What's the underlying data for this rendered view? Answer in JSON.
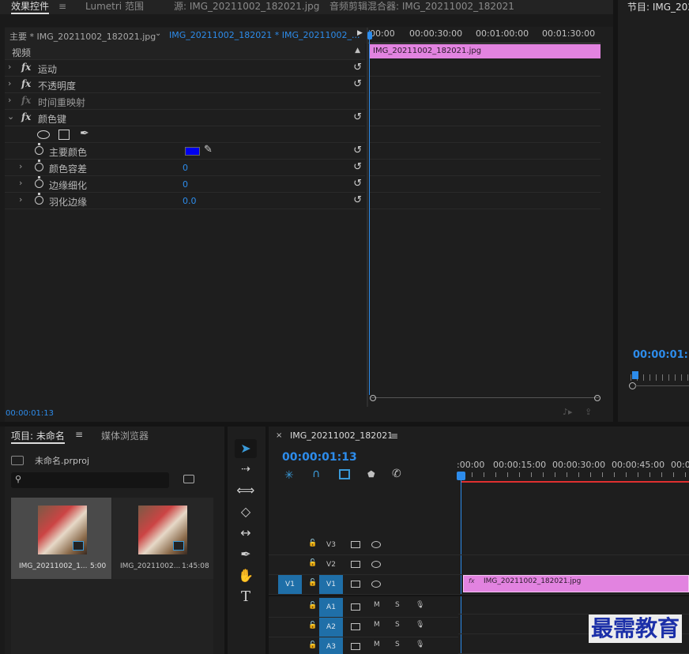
{
  "top_tabs": {
    "effect_controls": "效果控件",
    "lumetri": "Lumetri 范围",
    "source": "源: IMG_20211002_182021.jpg",
    "audio_mixer": "音频剪辑混合器: IMG_20211002_182021",
    "program": "节目: IMG_202"
  },
  "effect_controls": {
    "master_clip": "主要 * IMG_20211002_182021.jpg",
    "sequence_clip": "IMG_20211002_182021 * IMG_20211002_...",
    "section_video": "视频",
    "effects": [
      {
        "label": "运动"
      },
      {
        "label": "不透明度"
      },
      {
        "label": "时间重映射"
      },
      {
        "label": "颜色键"
      }
    ],
    "params": [
      {
        "label": "主要颜色",
        "value": ""
      },
      {
        "label": "颜色容差",
        "value": "0"
      },
      {
        "label": "边缘细化",
        "value": "0"
      },
      {
        "label": "羽化边缘",
        "value": "0.0"
      }
    ],
    "key_color": "#0000ee",
    "ruler": [
      "00:00",
      "00:00:30:00",
      "00:01:00:00",
      "00:01:30:00"
    ],
    "clip_name": "IMG_20211002_182021.jpg",
    "current_time": "00:00:01:13"
  },
  "program_monitor": {
    "timecode": "00:00:01:13"
  },
  "project": {
    "tab_project": "项目: 未命名",
    "tab_media": "媒体浏览器",
    "file_name": "未命名.prproj",
    "search_placeholder": "",
    "items": [
      {
        "name": "IMG_20211002_1...",
        "duration": "5:00"
      },
      {
        "name": "IMG_20211002...",
        "duration": "1:45:08"
      }
    ]
  },
  "timeline": {
    "sequence_name": "IMG_20211002_182021",
    "timecode": "00:00:01:13",
    "ruler": [
      ":00:00",
      "00:00:15:00",
      "00:00:30:00",
      "00:00:45:00",
      "00:0"
    ],
    "video_tracks": [
      "V3",
      "V2",
      "V1"
    ],
    "audio_tracks": [
      "A1",
      "A2",
      "A3"
    ],
    "source_patch": "V1",
    "mute_label": "M",
    "solo_label": "S",
    "clip_name": "IMG_20211002_182021.jpg",
    "clip_fx": "fx"
  },
  "watermark": "最需教育",
  "colors": {
    "accent": "#2d8ceb",
    "clip_pink": "#e283e0",
    "playhead_red": "#e03030"
  }
}
